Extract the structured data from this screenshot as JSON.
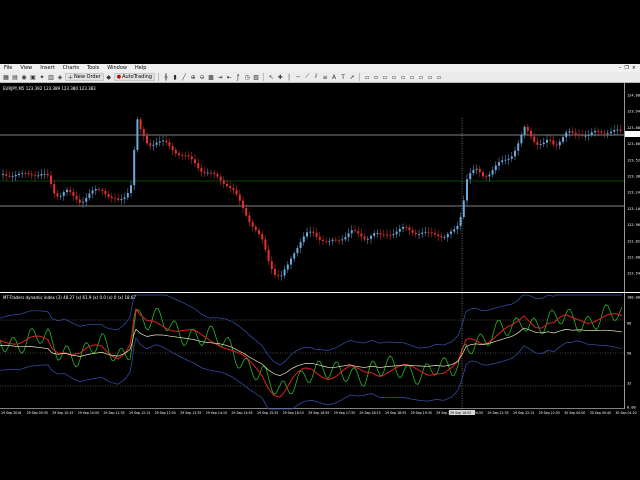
{
  "menu": {
    "items": [
      "File",
      "View",
      "Insert",
      "Charts",
      "Tools",
      "Window",
      "Help"
    ]
  },
  "toolbar": {
    "new_order": "New Order",
    "autotrading": "AutoTrading"
  },
  "chart": {
    "symbol_title": "EURJPY,M5  123.392 123.389 123.380 123.383",
    "indicator_title": "MT-Traders dynamic index (3) 48.27 (x) 61.9 (x) 0.0 (x) 0 (x) 18.67",
    "price_ticks": [
      "124.080",
      "123.940",
      "123.800",
      "123.660",
      "123.520",
      "123.383",
      "123.240",
      "123.100",
      "122.960",
      "122.820",
      "122.680",
      "122.540"
    ],
    "ind_ticks": [
      "100.00",
      "68",
      "50",
      "32",
      "0.00"
    ],
    "time_labels": [
      "29 Sep 2016",
      "29 Sep 09:35",
      "29 Sep 10:15",
      "29 Sep 10:55",
      "29 Sep 11:35",
      "29 Sep 12:15",
      "29 Sep 12:55",
      "29 Sep 13:35",
      "29 Sep 14:15",
      "29 Sep 14:55",
      "29 Sep 15:35",
      "29 Sep 16:15",
      "29 Sep 16:55",
      "29 Sep 17:35",
      "29 Sep 18:15",
      "29 Sep 18:55",
      "29 Sep 19:35",
      "29 Sep 20:15",
      "29 Sep 20:55",
      "29 Sep 21:35",
      "29 Sep 22:15",
      "29 Sep 22:55",
      "30 Sep 00:00",
      "30 Sep 00:40",
      "30 Sep 01:20"
    ],
    "cursor_time": "29 Sep 16:55",
    "colors": {
      "bull": "#6fa8dc",
      "bear": "#e53030",
      "level": "#ffffff",
      "green_level": "#1a8a1a",
      "ind_green": "#26b526",
      "ind_red": "#e52020",
      "ind_blue": "#3553b0",
      "ind_yellow": "#e6e6b8"
    }
  }
}
